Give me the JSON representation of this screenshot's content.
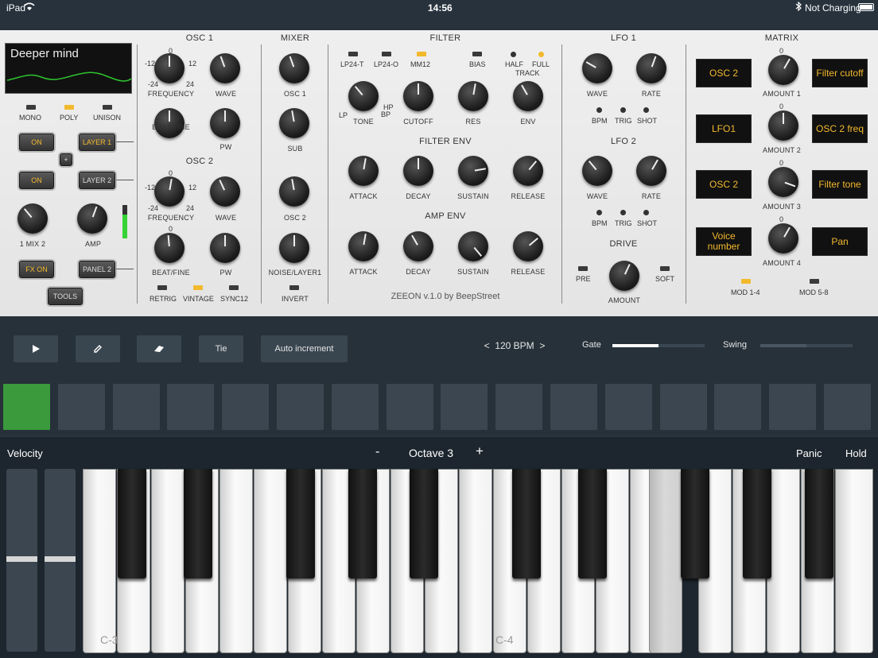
{
  "status": {
    "device": "iPad",
    "time": "14:56",
    "battery": "Not Charging"
  },
  "preset": {
    "name": "Deeper mind"
  },
  "voice": {
    "modes": [
      "MONO",
      "POLY",
      "UNISON"
    ],
    "active": "POLY",
    "on1": "ON",
    "layer1": "LAYER 1",
    "on2": "ON",
    "layer2": "LAYER 2",
    "plus": "+",
    "mix_label": "1 MIX 2",
    "amp_label": "AMP",
    "fx": "FX ON",
    "panel": "PANEL 2",
    "tools": "TOOLS"
  },
  "osc1": {
    "title": "OSC 1",
    "freq": "FREQUENCY",
    "wave": "WAVE",
    "beat": "BEAT/FINE",
    "pw": "PW",
    "s0": "0",
    "sm12": "-12",
    "s12": "12",
    "sm24": "-24",
    "s24": "24"
  },
  "osc2": {
    "title": "OSC 2",
    "freq": "FREQUENCY",
    "wave": "WAVE",
    "beat": "BEAT/FINE",
    "pw": "PW",
    "s0": "0",
    "sm12": "-12",
    "s12": "12",
    "sm24": "-24",
    "s24": "24",
    "s0b": "0",
    "retrig": "RETRIG",
    "vintage": "VINTAGE",
    "sync": "SYNC12"
  },
  "mixer": {
    "title": "MIXER",
    "osc1": "OSC 1",
    "sub": "SUB",
    "osc2": "OSC 2",
    "noise": "NOISE/LAYER1",
    "invert": "INVERT"
  },
  "filter": {
    "title": "FILTER",
    "types": [
      "LP24-T",
      "LP24-O",
      "MM12"
    ],
    "active": "MM12",
    "bias": "BIAS",
    "half": "HALF",
    "full": "FULL",
    "track": "TRACK",
    "tone": "TONE",
    "lp": "LP",
    "hp": "HP",
    "bp": "BP",
    "cutoff": "CUTOFF",
    "res": "RES",
    "env": "ENV"
  },
  "filter_env": {
    "title": "FILTER ENV",
    "a": "ATTACK",
    "d": "DECAY",
    "s": "SUSTAIN",
    "r": "RELEASE"
  },
  "amp_env": {
    "title": "AMP ENV",
    "a": "ATTACK",
    "d": "DECAY",
    "s": "SUSTAIN",
    "r": "RELEASE"
  },
  "footer": "ZEEON v.1.0  by BeepStreet",
  "lfo1": {
    "title": "LFO 1",
    "wave": "WAVE",
    "rate": "RATE",
    "bpm": "BPM",
    "trig": "TRIG",
    "shot": "SHOT"
  },
  "lfo2": {
    "title": "LFO 2",
    "wave": "WAVE",
    "rate": "RATE",
    "bpm": "BPM",
    "trig": "TRIG",
    "shot": "SHOT"
  },
  "drive": {
    "title": "DRIVE",
    "pre": "PRE",
    "soft": "SOFT",
    "amount": "AMOUNT"
  },
  "matrix": {
    "title": "MATRIX",
    "src": [
      "OSC 2",
      "LFO1",
      "OSC 2",
      "Voice number"
    ],
    "dst": [
      "Filter cutoff",
      "OSC 2 freq",
      "Filter tone",
      "Pan"
    ],
    "amt": [
      "AMOUNT 1",
      "AMOUNT 2",
      "AMOUNT 3",
      "AMOUNT 4"
    ],
    "zero": "0",
    "mod14": "MOD 1-4",
    "mod58": "MOD 5-8"
  },
  "transport": {
    "tie": "Tie",
    "auto": "Auto increment",
    "bpm": "<  120 BPM  >",
    "gate": "Gate",
    "swing": "Swing",
    "gate_value": 0.5,
    "swing_value": 0.5
  },
  "steps": {
    "active_index": 0,
    "count": 16
  },
  "keyboard": {
    "velocity": "Velocity",
    "minus": "-",
    "octave": "Octave 3",
    "plus": "+",
    "panic": "Panic",
    "hold": "Hold",
    "c3": "C-3",
    "c4": "C-4"
  },
  "colors": {
    "accent": "#f3b92d",
    "step_on": "#3a9a3c",
    "bg": "#283440"
  }
}
